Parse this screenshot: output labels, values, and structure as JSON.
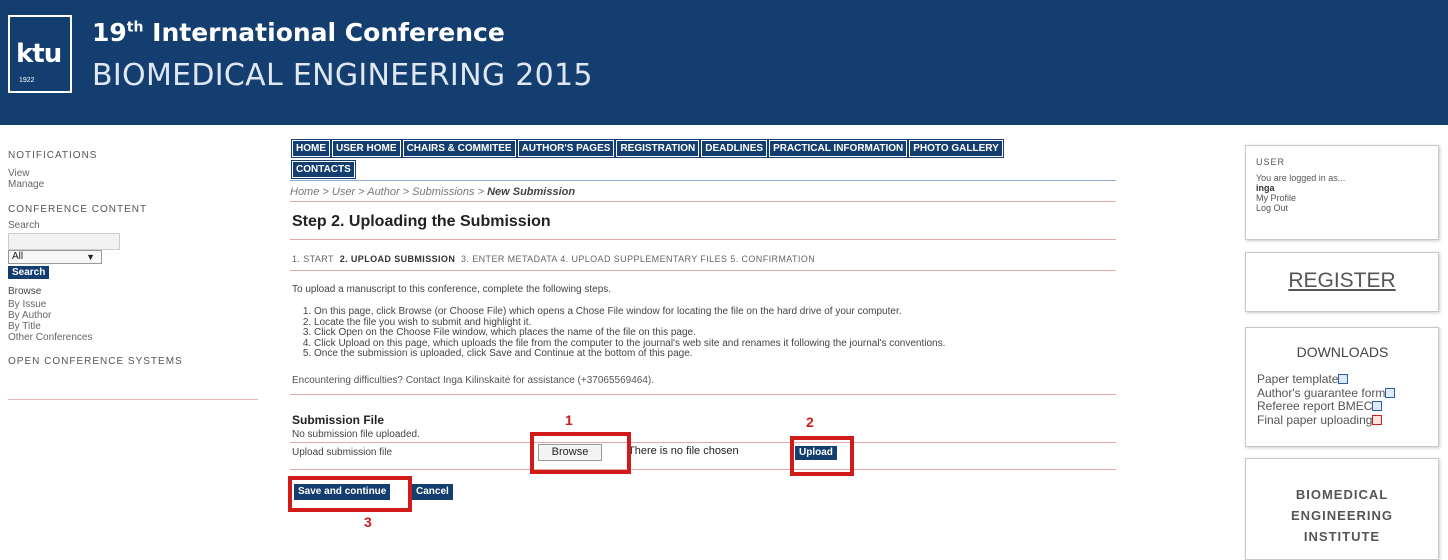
{
  "header": {
    "logo_text": "ktu",
    "logo_year": "1922",
    "line1_num": "19",
    "line1_sup": "th",
    "line1_rest": " International Conference",
    "line2": "BIOMEDICAL ENGINEERING 2015",
    "bg_color": "#133e6f"
  },
  "left": {
    "notifications_title": "NOTIFICATIONS",
    "notifications_links": [
      "View",
      "Manage"
    ],
    "content_title": "CONFERENCE CONTENT",
    "search_label": "Search",
    "search_value": "",
    "select_value": "All",
    "search_button": "Search",
    "browse_title": "Browse",
    "browse_links": [
      "By Issue",
      "By Author",
      "By Title",
      "Other Conferences"
    ],
    "ocs_title": "OPEN CONFERENCE SYSTEMS"
  },
  "nav": [
    "HOME",
    "USER HOME",
    "CHAIRS & COMMITEE",
    "AUTHOR'S PAGES",
    "REGISTRATION",
    "DEADLINES",
    "PRACTICAL INFORMATION",
    "PHOTO GALLERY",
    "CONTACTS"
  ],
  "main": {
    "breadcrumb": "Home > User > Author > Submissions > ",
    "breadcrumb_current": "New Submission",
    "title": "Step 2. Uploading the Submission",
    "steps_1": "1. START",
    "steps_2": "2. UPLOAD SUBMISSION",
    "steps_rest": "3. ENTER METADATA  4. UPLOAD SUPPLEMENTARY FILES  5. CONFIRMATION",
    "intro": "To upload a manuscript to this conference, complete the following steps.",
    "instructions": [
      "On this page, click Browse (or Choose File) which opens a Chose File window for locating the file on the hard drive of your computer.",
      "Locate the file you wish to submit and highlight it.",
      "Click Open on the Choose File window, which places the name of the file on this page.",
      "Click Upload on this page, which uploads the file from the computer to the journal's web site and renames it following the journal's conventions.",
      "Once the submission is uploaded, click Save and Continue at the bottom of this page."
    ],
    "difficulties_pre": "Encountering difficulties? Contact ",
    "difficulties_name": "Inga Kilinskaitė",
    "difficulties_post": " for assistance (+37065569464).",
    "subfile_title": "Submission File",
    "no_file": "No submission file uploaded.",
    "upload_label": "Upload submission file",
    "browse_button": "Browse",
    "no_file_chosen": "There is no file chosen",
    "upload_button": "Upload",
    "save_button": "Save and continue",
    "cancel_button": "Cancel",
    "annotation_1": "1",
    "annotation_2": "2",
    "annotation_3": "3",
    "annotation_color": "#d11a1a"
  },
  "right": {
    "user_title": "USER",
    "logged_in": "You are logged in as...",
    "username": "inga",
    "my_profile": "My Profile",
    "log_out": "Log Out",
    "register": "REGISTER",
    "downloads_title": "DOWNLOADS",
    "downloads": [
      {
        "label": "Paper template",
        "icon": "word-doc-icon"
      },
      {
        "label": "Author's guarantee form",
        "icon": "word-doc-icon"
      },
      {
        "label": "Referee report BMEC",
        "icon": "word-doc-icon"
      },
      {
        "label": "Final paper uploading",
        "icon": "pdf-icon"
      }
    ],
    "institute_line1": "BIOMEDICAL",
    "institute_line2": "ENGINEERING",
    "institute_line3": "INSTITUTE"
  }
}
